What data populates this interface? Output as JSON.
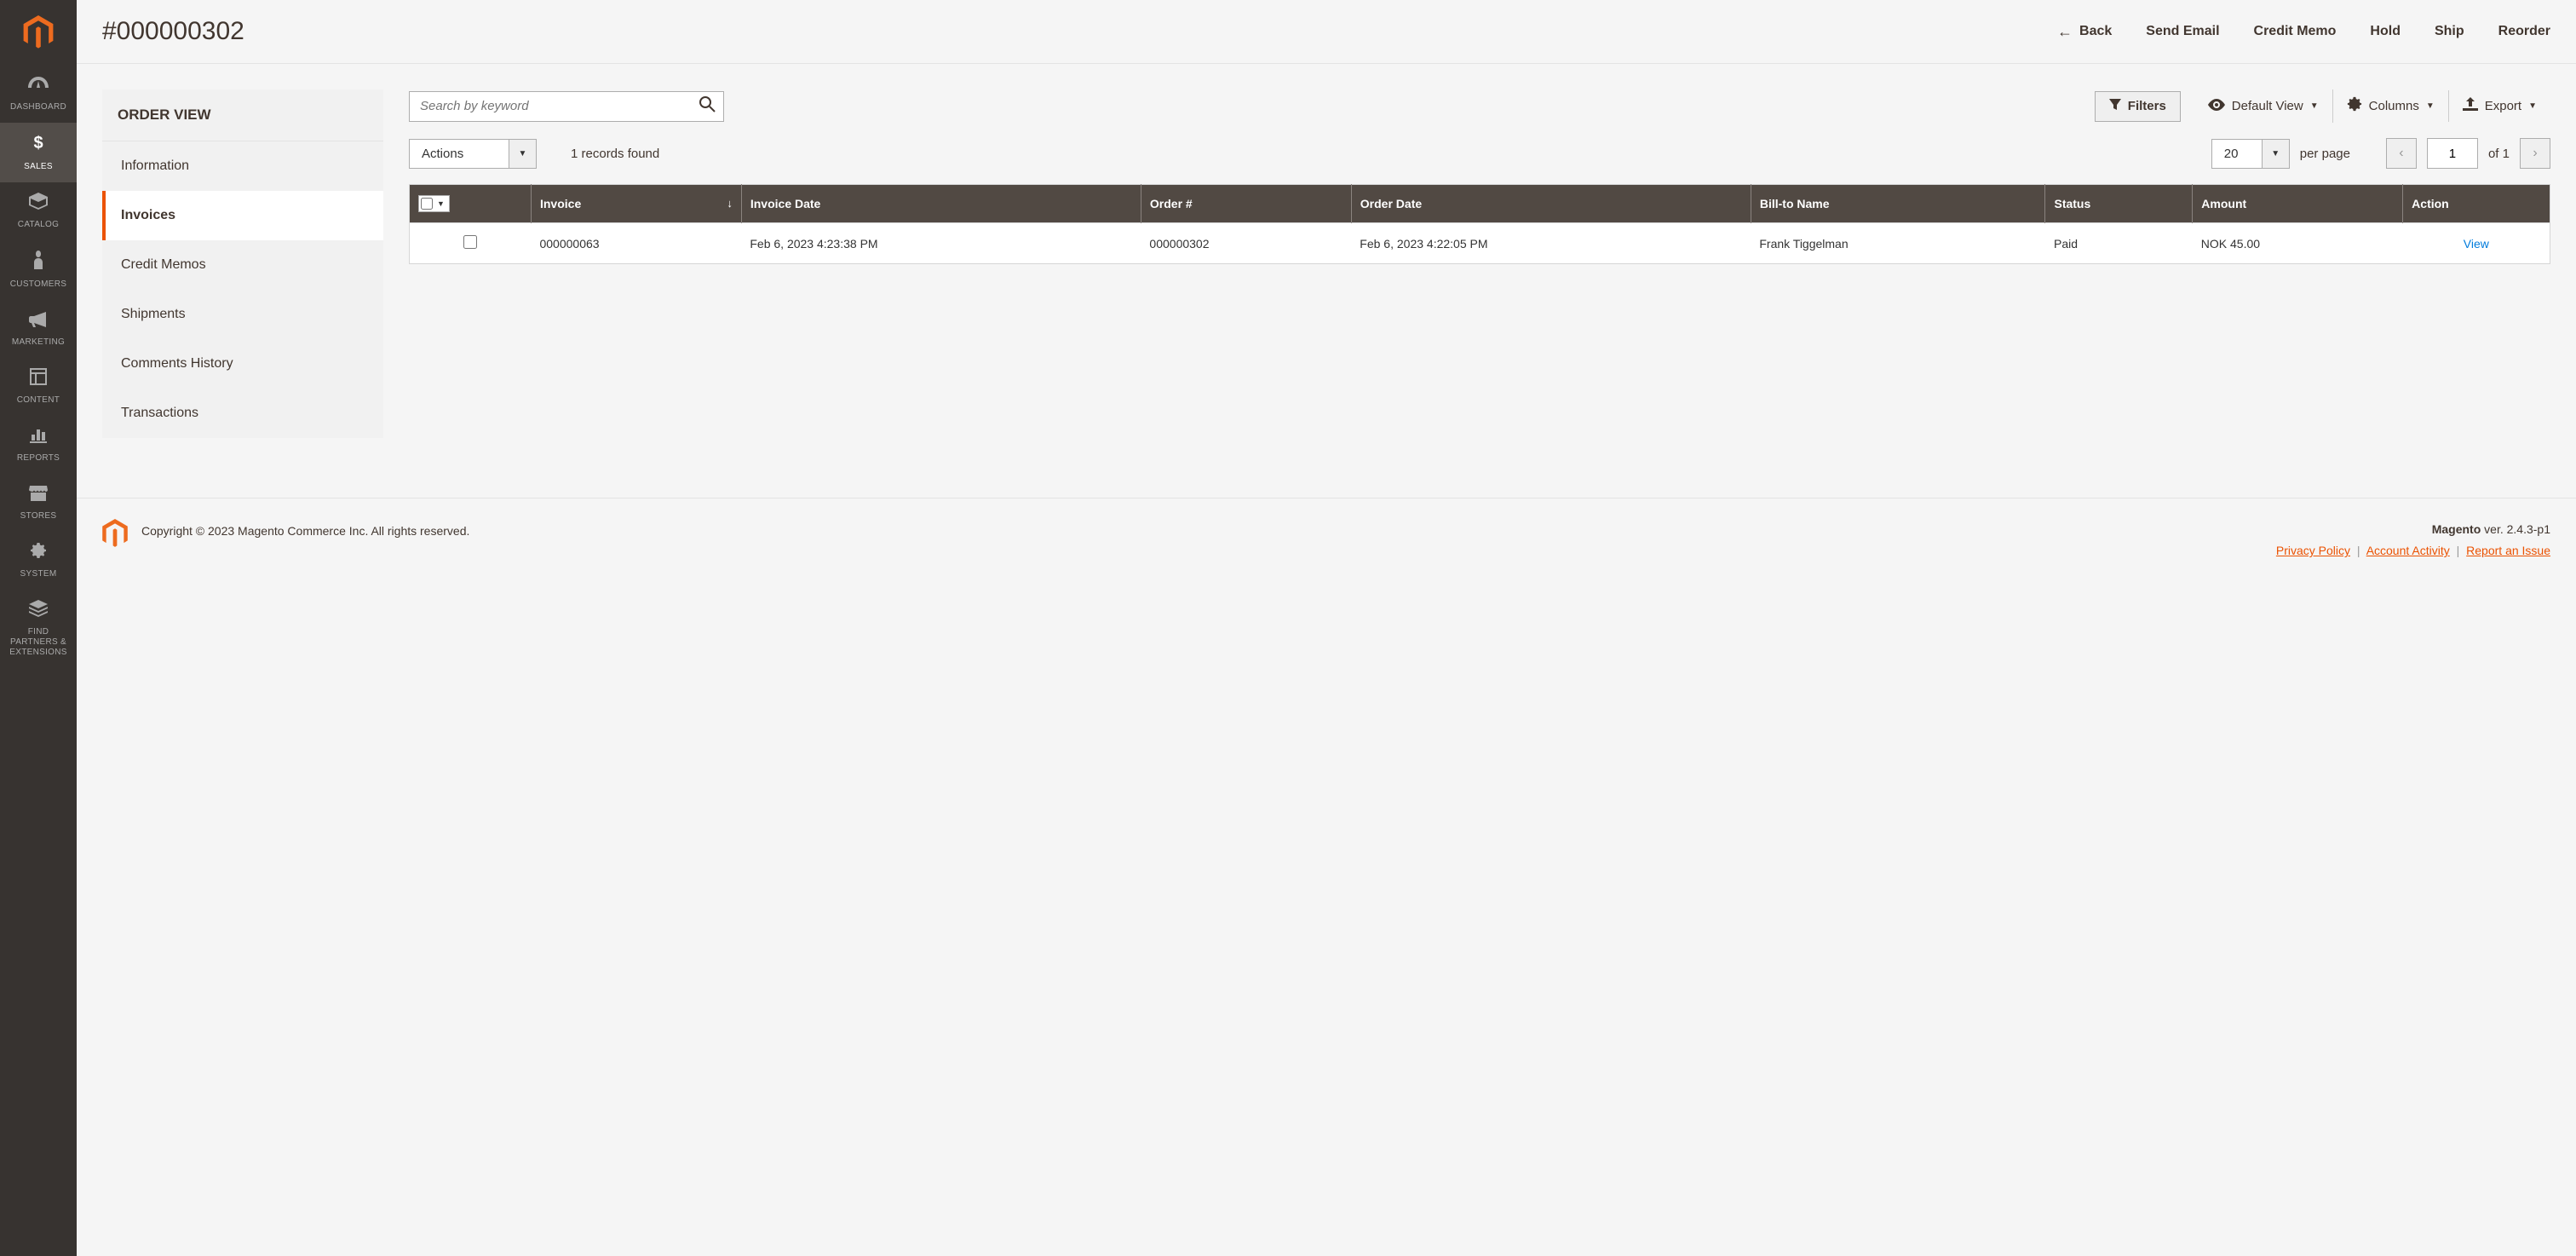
{
  "page_title": "#000000302",
  "sidebar": {
    "items": [
      {
        "label": "DASHBOARD"
      },
      {
        "label": "SALES"
      },
      {
        "label": "CATALOG"
      },
      {
        "label": "CUSTOMERS"
      },
      {
        "label": "MARKETING"
      },
      {
        "label": "CONTENT"
      },
      {
        "label": "REPORTS"
      },
      {
        "label": "STORES"
      },
      {
        "label": "SYSTEM"
      },
      {
        "label": "FIND PARTNERS & EXTENSIONS"
      }
    ]
  },
  "header_actions": {
    "back": "Back",
    "send_email": "Send Email",
    "credit_memo": "Credit Memo",
    "hold": "Hold",
    "ship": "Ship",
    "reorder": "Reorder"
  },
  "order_view": {
    "title": "ORDER VIEW",
    "tabs": {
      "information": "Information",
      "invoices": "Invoices",
      "credit_memos": "Credit Memos",
      "shipments": "Shipments",
      "comments_history": "Comments History",
      "transactions": "Transactions"
    }
  },
  "toolbar": {
    "search_placeholder": "Search by keyword",
    "filters": "Filters",
    "default_view": "Default View",
    "columns": "Columns",
    "export": "Export",
    "actions": "Actions",
    "records_found": "1 records found",
    "per_page_value": "20",
    "per_page_label": "per page",
    "page_current": "1",
    "page_of": "of 1"
  },
  "table": {
    "headers": {
      "invoice": "Invoice",
      "invoice_date": "Invoice Date",
      "order_num": "Order #",
      "order_date": "Order Date",
      "bill_to": "Bill-to Name",
      "status": "Status",
      "amount": "Amount",
      "action": "Action"
    },
    "rows": [
      {
        "invoice": "000000063",
        "invoice_date": "Feb 6, 2023 4:23:38 PM",
        "order_num": "000000302",
        "order_date": "Feb 6, 2023 4:22:05 PM",
        "bill_to": "Frank Tiggelman",
        "status": "Paid",
        "amount": "NOK 45.00",
        "action": "View"
      }
    ]
  },
  "footer": {
    "copyright": "Copyright © 2023 Magento Commerce Inc. All rights reserved.",
    "product": "Magento",
    "version": " ver. 2.4.3-p1",
    "privacy": "Privacy Policy",
    "activity": "Account Activity",
    "report": "Report an Issue"
  }
}
